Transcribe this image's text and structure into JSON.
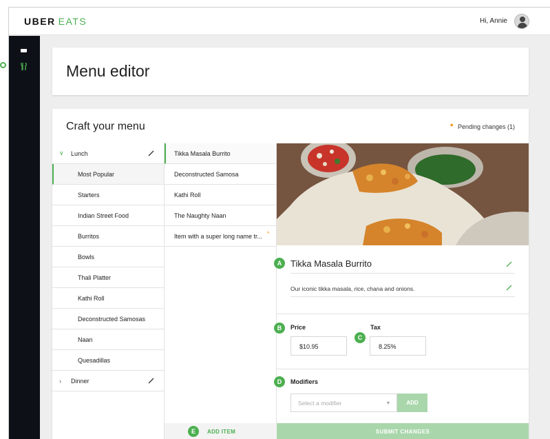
{
  "brand": {
    "uber": "UBER",
    "eats": "EATS"
  },
  "header": {
    "greeting": "Hi, Annie"
  },
  "nav": {
    "icons": [
      "card-icon",
      "fork-knife-icon"
    ]
  },
  "page": {
    "title": "Menu editor"
  },
  "editor": {
    "title": "Craft your menu",
    "pending": "Pending changes (1)"
  },
  "categories": [
    {
      "label": "Lunch",
      "expanded": true,
      "subcategories": [
        "Most Popular",
        "Starters",
        "Indian Street Food",
        "Burritos",
        "Bowls",
        "Thali Platter",
        "Kathi Roll",
        "Deconstructed Samosas",
        "Naan",
        "Quesadillas"
      ],
      "active_index": 0
    },
    {
      "label": "Dinner",
      "expanded": false
    }
  ],
  "items": [
    {
      "label": "Tikka Masala Burrito",
      "active": true
    },
    {
      "label": "Deconstructed Samosa"
    },
    {
      "label": "Kathi Roll"
    },
    {
      "label": "The Naughty Naan"
    },
    {
      "label": "Item with a super long name tr...",
      "pending": true
    }
  ],
  "add_item": "ADD ITEM",
  "detail": {
    "name": "Tikka Masala Burrito",
    "description": "Our iconic tikka masala, rice, chana and onions.",
    "price_label": "Price",
    "price": "$10.95",
    "tax_label": "Tax",
    "tax": "8.25%",
    "modifiers_label": "Modifiers",
    "modifier_placeholder": "Select a modifier",
    "add_label": "ADD",
    "submit": "SUBMIT CHANGES"
  },
  "markers": {
    "a": "A",
    "b": "B",
    "c": "C",
    "d": "D",
    "e": "E"
  },
  "colors": {
    "accent": "#4caf50",
    "accent_light": "#a9d7ab",
    "pending": "#f0a020",
    "sidebar": "#0d1117"
  }
}
